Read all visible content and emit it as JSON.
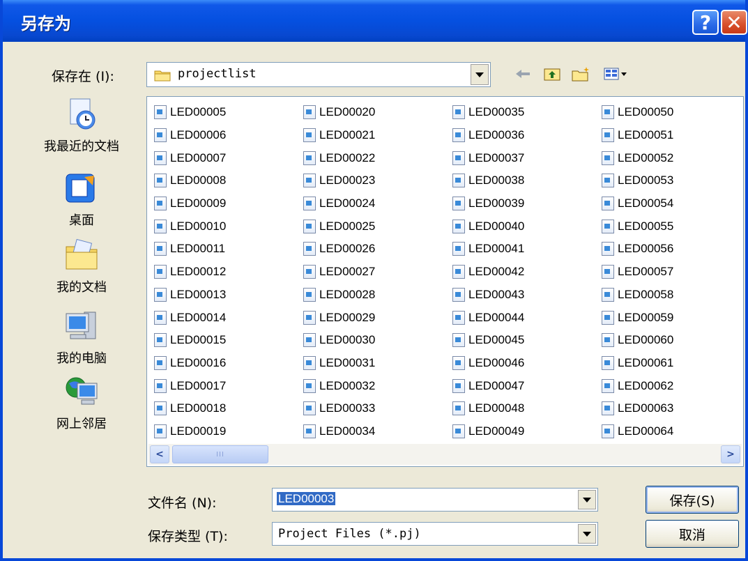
{
  "window": {
    "title": "另存为"
  },
  "titlebar": {
    "help_glyph": "?",
    "close_glyph": "✕"
  },
  "save_in": {
    "label": "保存在 (I):",
    "value": "projectlist"
  },
  "toolbar": {
    "back_icon": "back-arrow-icon",
    "up_icon": "up-folder-icon",
    "new_folder_icon": "new-folder-icon",
    "view_icon": "view-menu-icon"
  },
  "places": [
    {
      "label": "我最近的文档",
      "icon": "recent-documents-icon"
    },
    {
      "label": "桌面",
      "icon": "desktop-icon"
    },
    {
      "label": "我的文档",
      "icon": "my-documents-icon"
    },
    {
      "label": "我的电脑",
      "icon": "my-computer-icon"
    },
    {
      "label": "网上邻居",
      "icon": "network-places-icon"
    }
  ],
  "files": {
    "columns": [
      [
        "LED00005",
        "LED00006",
        "LED00007",
        "LED00008",
        "LED00009",
        "LED00010",
        "LED00011",
        "LED00012",
        "LED00013",
        "LED00014",
        "LED00015",
        "LED00016",
        "LED00017",
        "LED00018",
        "LED00019"
      ],
      [
        "LED00020",
        "LED00021",
        "LED00022",
        "LED00023",
        "LED00024",
        "LED00025",
        "LED00026",
        "LED00027",
        "LED00028",
        "LED00029",
        "LED00030",
        "LED00031",
        "LED00032",
        "LED00033",
        "LED00034"
      ],
      [
        "LED00035",
        "LED00036",
        "LED00037",
        "LED00038",
        "LED00039",
        "LED00040",
        "LED00041",
        "LED00042",
        "LED00043",
        "LED00044",
        "LED00045",
        "LED00046",
        "LED00047",
        "LED00048",
        "LED00049"
      ],
      [
        "LED00050",
        "LED00051",
        "LED00052",
        "LED00053",
        "LED00054",
        "LED00055",
        "LED00056",
        "LED00057",
        "LED00058",
        "LED00059",
        "LED00060",
        "LED00061",
        "LED00062",
        "LED00063",
        "LED00064"
      ]
    ]
  },
  "scrollbar": {
    "thumb_grip": "III",
    "left_arrow": "<",
    "right_arrow": ">"
  },
  "filename": {
    "label": "文件名 (N):",
    "value": "LED00003"
  },
  "filetype": {
    "label": "保存类型 (T):",
    "value": "Project Files (*.pj)"
  },
  "buttons": {
    "save": "保存(S)",
    "cancel": "取消"
  },
  "colors": {
    "titlebar": "#0550e0",
    "selection": "#316ac5",
    "dialog_bg": "#ece9d8"
  }
}
